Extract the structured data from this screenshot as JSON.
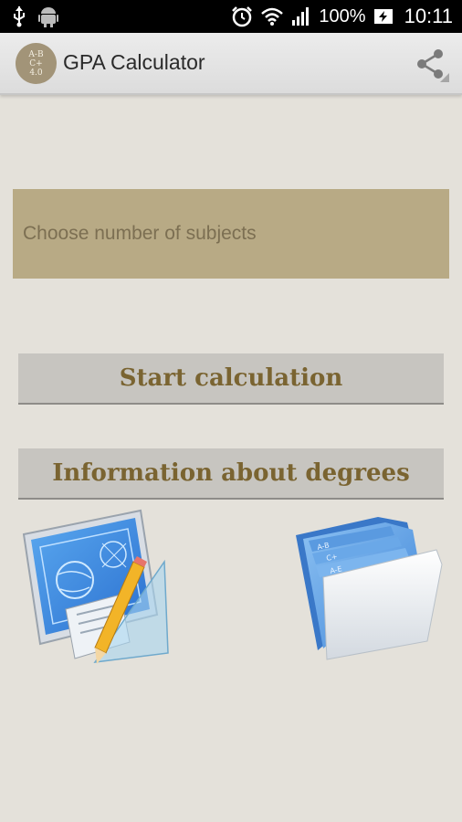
{
  "status_bar": {
    "battery": "100%",
    "time": "10:11",
    "icons": [
      "usb-icon",
      "android-icon",
      "alarm-icon",
      "wifi-icon",
      "signal-icon",
      "battery-charging-icon"
    ]
  },
  "action_bar": {
    "app_icon_lines": [
      "A-B",
      "C+",
      "4.0"
    ],
    "title": "GPA Calculator",
    "share_icon": "share-icon"
  },
  "spinner": {
    "placeholder": "Choose number of subjects"
  },
  "buttons": {
    "start": "Start calculation",
    "info": "Information about degrees"
  },
  "illustrations": {
    "left": "blueprint-pencil-icon",
    "right": "blue-folder-icon",
    "folder_tabs": [
      "A-B",
      "C+",
      "A-E"
    ]
  },
  "colors": {
    "accent": "#7a6431",
    "spinner_bg": "#b8aa85",
    "button_bg": "#c7c5c0",
    "page_bg": "#e4e1da"
  }
}
